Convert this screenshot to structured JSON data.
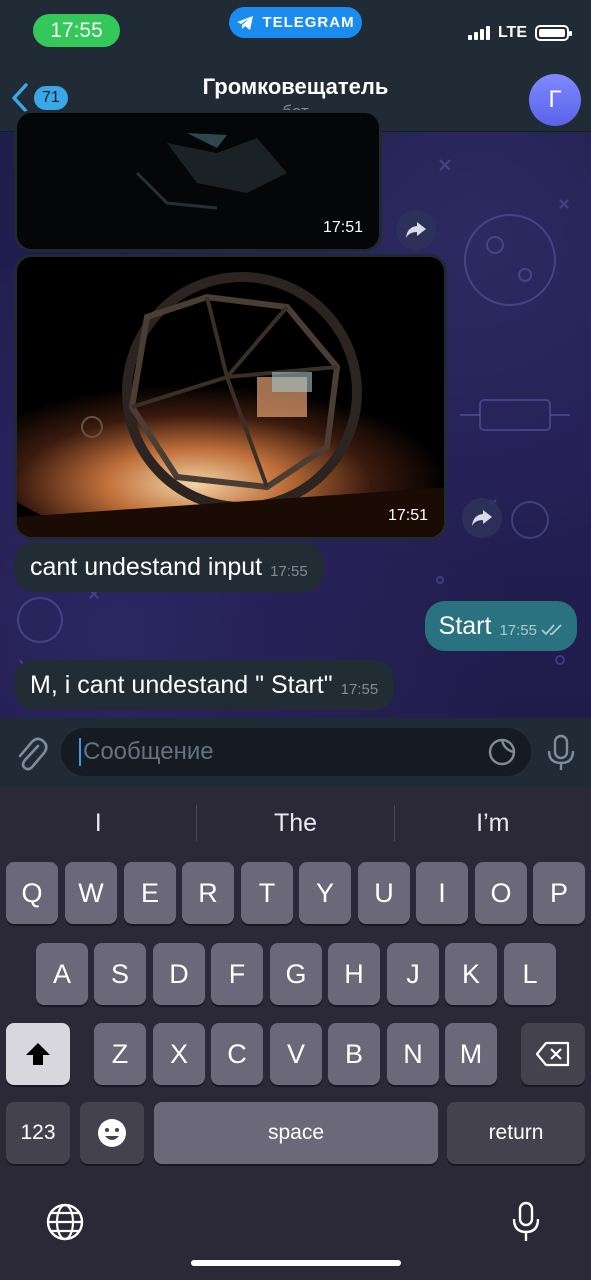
{
  "status_bar": {
    "time": "17:55",
    "app_pill": "TELEGRAM",
    "network": "LTE"
  },
  "header": {
    "back_count": "71",
    "title": "Громковещатель",
    "subtitle": "бот",
    "avatar_letter": "Г"
  },
  "messages": [
    {
      "type": "photo",
      "time": "17:51",
      "direction": "in"
    },
    {
      "type": "photo",
      "time": "17:51",
      "direction": "in"
    },
    {
      "type": "text",
      "text": "cant undestand input",
      "time": "17:55",
      "direction": "in"
    },
    {
      "type": "text",
      "text": "Start",
      "time": "17:55",
      "direction": "out"
    },
    {
      "type": "text",
      "text": "M, i cant undestand \" Start\"",
      "time": "17:55",
      "direction": "in"
    }
  ],
  "input": {
    "placeholder": "Сообщение"
  },
  "keyboard": {
    "suggestions": [
      "I",
      "The",
      "I’m"
    ],
    "row1": [
      "Q",
      "W",
      "E",
      "R",
      "T",
      "Y",
      "U",
      "I",
      "O",
      "P"
    ],
    "row2": [
      "A",
      "S",
      "D",
      "F",
      "G",
      "H",
      "J",
      "K",
      "L"
    ],
    "row3": [
      "Z",
      "X",
      "C",
      "V",
      "B",
      "N",
      "M"
    ],
    "numbers_key": "123",
    "space_key": "space",
    "return_key": "return"
  },
  "colors": {
    "outgoing_bubble": "#2b7281",
    "incoming_bubble": "#222c35",
    "accent": "#3aa7e8",
    "time_pill": "#34c759"
  }
}
